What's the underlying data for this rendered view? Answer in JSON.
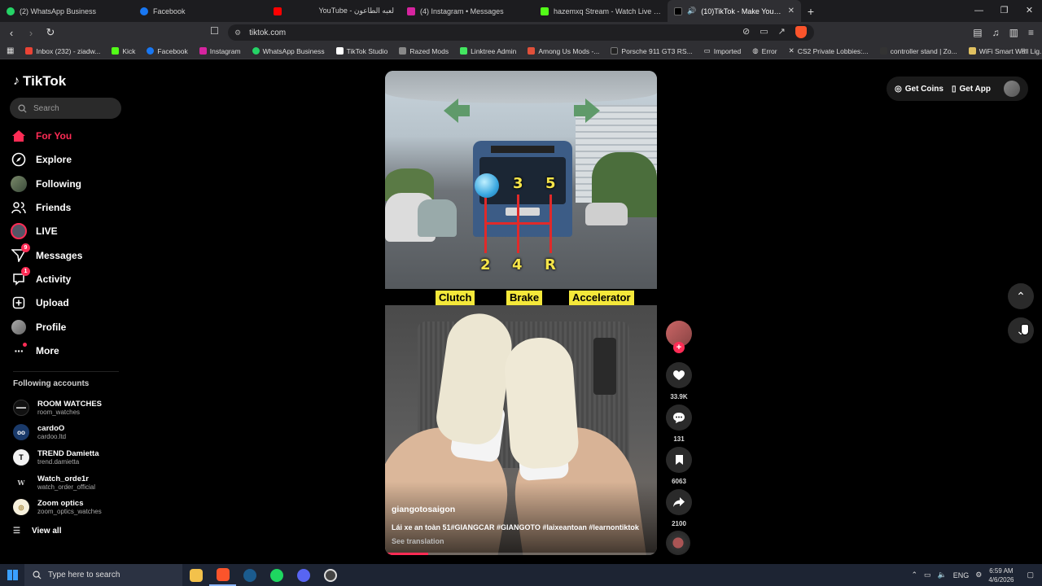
{
  "browser": {
    "tabs": [
      {
        "label": "(2) WhatsApp Business",
        "favicon_color": "#25d366"
      },
      {
        "label": "Facebook",
        "favicon_color": "#1877f2"
      },
      {
        "label": "YouTube - لعبه الطاعون",
        "favicon_color": "#ff0000"
      },
      {
        "label": "(4) Instagram • Messages",
        "favicon_color": "#d6249f"
      },
      {
        "label": "hazemxq Stream - Watch Live on Kick",
        "favicon_color": "#53fc18"
      },
      {
        "label": "(10)TikTok - Make Your Day",
        "favicon_color": "#000000"
      }
    ],
    "url": "tiktok.com",
    "bookmarks": [
      {
        "label": "Inbox (232) - ziadw...",
        "color": "#ea4335"
      },
      {
        "label": "Kick",
        "color": "#53fc18"
      },
      {
        "label": "Facebook",
        "color": "#1877f2"
      },
      {
        "label": "Instagram",
        "color": "#d6249f"
      },
      {
        "label": "WhatsApp Business",
        "color": "#25d366"
      },
      {
        "label": "TikTok Studio",
        "color": "#ffffff"
      },
      {
        "label": "Razed Mods",
        "color": "#888888"
      },
      {
        "label": "Linktree Admin",
        "color": "#43e660"
      },
      {
        "label": "Among Us Mods -...",
        "color": "#e0503a"
      },
      {
        "label": "Porsche 911 GT3 RS...",
        "color": "#222222"
      },
      {
        "label": "Imported",
        "color": "#bbbbbb"
      },
      {
        "label": "Error",
        "color": "#bbbbbb"
      },
      {
        "label": "CS2 Private Lobbies:...",
        "color": "#ffffff"
      },
      {
        "label": "controller stand | Zo...",
        "color": "#333333"
      },
      {
        "label": "WiFi Smart Wall Lig...",
        "color": "#e0c060"
      }
    ]
  },
  "sidebar": {
    "logo": "TikTok",
    "search_placeholder": "Search",
    "nav": [
      {
        "label": "For You",
        "icon": "home-icon"
      },
      {
        "label": "Explore",
        "icon": "compass-icon"
      },
      {
        "label": "Following",
        "icon": "following-avatar-icon"
      },
      {
        "label": "Friends",
        "icon": "friends-icon"
      },
      {
        "label": "LIVE",
        "icon": "live-icon"
      },
      {
        "label": "Messages",
        "icon": "messages-icon",
        "badge": "9"
      },
      {
        "label": "Activity",
        "icon": "activity-icon",
        "badge": "1"
      },
      {
        "label": "Upload",
        "icon": "upload-icon"
      },
      {
        "label": "Profile",
        "icon": "profile-icon"
      },
      {
        "label": "More",
        "icon": "more-icon"
      }
    ],
    "following_title": "Following accounts",
    "accounts": [
      {
        "name": "ROOM WATCHES",
        "handle": "room_watches",
        "avatar_color": "#111111",
        "initials": ""
      },
      {
        "name": "cardoO",
        "handle": "cardoo.ltd",
        "avatar_color": "#1a3a6a",
        "initials": "oo"
      },
      {
        "name": "TREND Damietta",
        "handle": "trend.damietta",
        "avatar_color": "#f2f2f2",
        "initials": ""
      },
      {
        "name": "Watch_orde1r",
        "handle": "watch_order_official",
        "avatar_color": "#000000",
        "initials": "W"
      },
      {
        "name": "Zoom optics",
        "handle": "zoom_optics_watches",
        "avatar_color": "#f6f0dc",
        "initials": ""
      }
    ],
    "view_all": "View all"
  },
  "video": {
    "gear_top": [
      "3",
      "5"
    ],
    "gear_bottom": [
      "2",
      "4",
      "R"
    ],
    "pedal_labels": [
      "Clutch",
      "Brake",
      "Accelerator"
    ],
    "author": "giangotosaigon",
    "caption": "Lái xe an toàn 51#GIANGCAR #GIANGOTO #laixeantoan #learnontiktok",
    "see_translation": "See translation",
    "progress": 0.16
  },
  "actions": {
    "likes": "33.9K",
    "comments": "131",
    "saves": "6063",
    "shares": "2100"
  },
  "topright": {
    "get_coins": "Get Coins",
    "get_app": "Get App"
  },
  "taskbar": {
    "search_placeholder": "Type here to search",
    "language": "ENG",
    "time": "6:59 AM",
    "date": "4/6/2026"
  }
}
